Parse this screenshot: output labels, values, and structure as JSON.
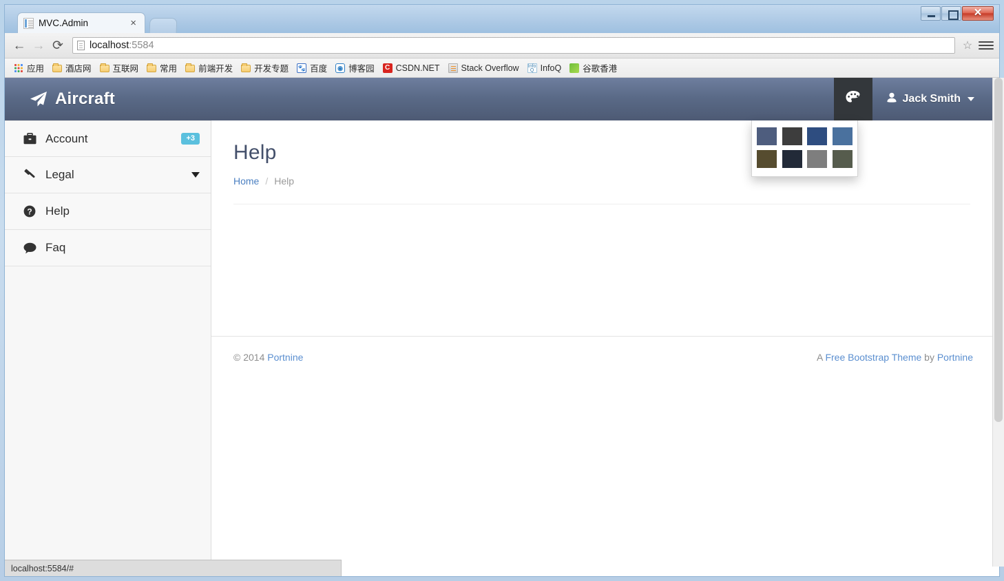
{
  "browser": {
    "tab_title": "MVC.Admin",
    "tab_close_label": "×",
    "back_icon": "←",
    "forward_icon": "→",
    "reload_icon": "⟳",
    "url_host": "localhost",
    "url_rest": ":5584",
    "star_icon": "☆",
    "status_text": "localhost:5584/#",
    "window_buttons": {
      "minimize": "minimize",
      "maximize": "maximize",
      "close": "close"
    },
    "bookmarks": [
      {
        "label": "应用",
        "icon": "apps-grid-icon"
      },
      {
        "label": "酒店网",
        "icon": "folder-icon"
      },
      {
        "label": "互联网",
        "icon": "folder-icon"
      },
      {
        "label": "常用",
        "icon": "folder-icon"
      },
      {
        "label": "前端开发",
        "icon": "folder-icon"
      },
      {
        "label": "开发专题",
        "icon": "folder-icon"
      },
      {
        "label": "百度",
        "icon": "baidu-icon"
      },
      {
        "label": "博客园",
        "icon": "bokeyuan-icon"
      },
      {
        "label": "CSDN.NET",
        "icon": "csdn-icon"
      },
      {
        "label": "Stack Overflow",
        "icon": "stackoverflow-icon"
      },
      {
        "label": "InfoQ",
        "icon": "infoq-icon"
      },
      {
        "label": "谷歌香港",
        "icon": "google-icon"
      }
    ]
  },
  "app": {
    "brand": "Aircraft",
    "brand_icon": "paper-plane-icon",
    "theme_toggle_icon": "palette-icon",
    "user": {
      "name": "Jack Smith",
      "icon": "user-icon",
      "caret": "caret-down-icon"
    },
    "theme_dropdown": {
      "open": true,
      "swatches": [
        {
          "name": "theme-slate-blue",
          "color": "#4e5d7e"
        },
        {
          "name": "theme-charcoal",
          "color": "#3d3d3d"
        },
        {
          "name": "theme-navy",
          "color": "#2e4d80"
        },
        {
          "name": "theme-steel-blue",
          "color": "#4a719e"
        },
        {
          "name": "theme-olive",
          "color": "#564c2f"
        },
        {
          "name": "theme-midnight",
          "color": "#222a38"
        },
        {
          "name": "theme-gray",
          "color": "#7e7e7e"
        },
        {
          "name": "theme-moss",
          "color": "#565c4d"
        }
      ]
    },
    "sidebar": {
      "items": [
        {
          "label": "Account",
          "icon": "briefcase-icon",
          "badge": "+3",
          "chevron": false
        },
        {
          "label": "Legal",
          "icon": "gavel-icon",
          "badge": "",
          "chevron": true
        },
        {
          "label": "Help",
          "icon": "question-circle-icon",
          "badge": "",
          "chevron": false
        },
        {
          "label": "Faq",
          "icon": "comment-icon",
          "badge": "",
          "chevron": false
        }
      ]
    },
    "main": {
      "page_title": "Help",
      "breadcrumb": {
        "home": "Home",
        "separator": "/",
        "current": "Help"
      }
    },
    "footer": {
      "copyright_symbol": "© 2014",
      "copyright_link": "Portnine",
      "right_prefix": "A",
      "right_link_1": "Free Bootstrap Theme",
      "right_middle": "by",
      "right_link_2": "Portnine"
    }
  },
  "colors": {
    "header_top": "#6e7e9e",
    "header_bottom": "#4d5a74",
    "badge": "#5bc0de",
    "link": "#4a7fc1",
    "title": "#44506b"
  }
}
